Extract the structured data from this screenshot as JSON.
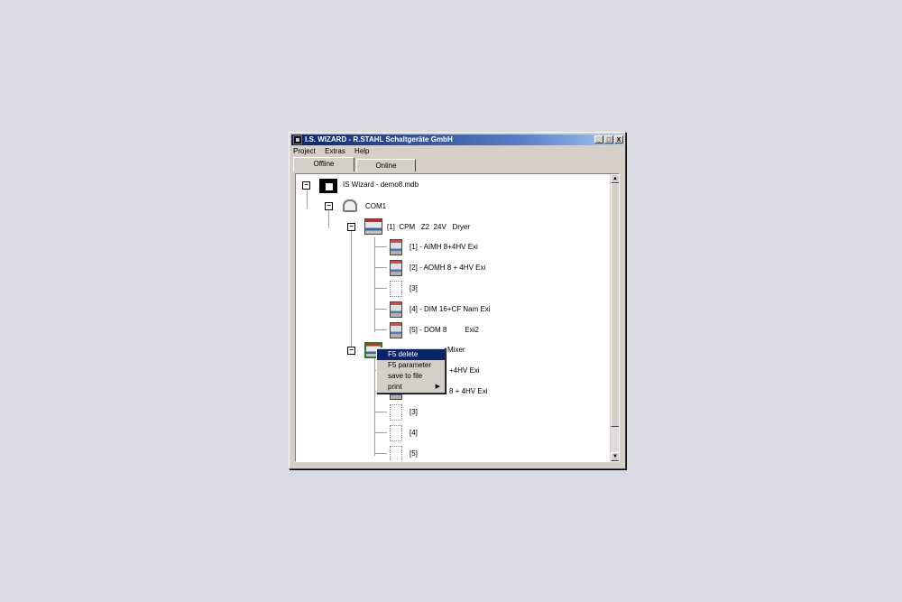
{
  "window": {
    "title": "I.S. WIZARD - R.STAHL Schaltgeräte GmbH",
    "minimize": "_",
    "maximize": "□",
    "close": "X"
  },
  "menu": [
    "Project",
    "Extras",
    "Help"
  ],
  "tabs": [
    "Offline",
    "Online"
  ],
  "tree": {
    "root": "IS Wizard - demo8.mdb",
    "port": "COM1",
    "cpm1": "[1]  CPM   Z2  24V   Dryer",
    "cpm1_items": [
      "[1] - AIMH 8+4HV Exi",
      "[2] - AOMH 8 + 4HV Exi",
      "[3]",
      "[4] - DIM 16+CF Nam Exi",
      "[5] - DOM 8         Exi2"
    ],
    "cpm2_suffix": "Mixer",
    "cpm2_item1_tail": "+4HV Exi",
    "cpm2_item2_tail": "8 + 4HV Exi",
    "cpm2_items": [
      "[3]",
      "[4]",
      "[5]"
    ]
  },
  "context_menu": {
    "items": [
      "F5 delete",
      "F5 parameter",
      "save to file",
      "print"
    ],
    "submenu_arrow": "▶"
  },
  "scrollbar": {
    "up": "▲",
    "down": "▼"
  }
}
